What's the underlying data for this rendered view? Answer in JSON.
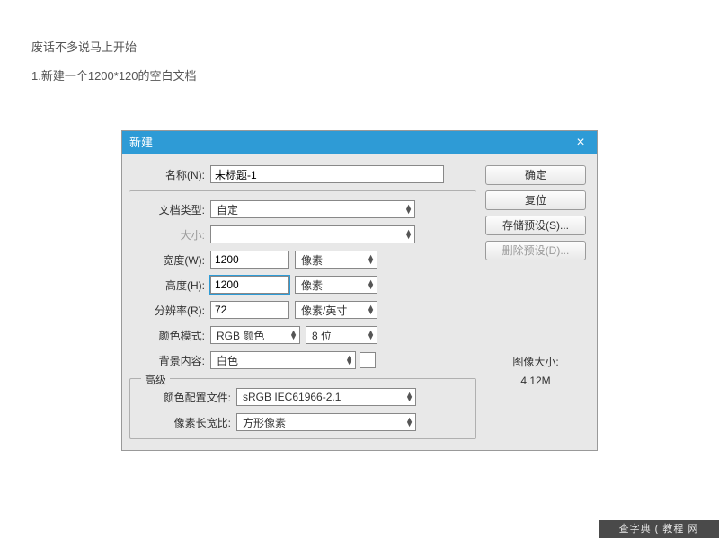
{
  "page": {
    "intro1": "废话不多说马上开始",
    "intro2": "1.新建一个1200*120的空白文档"
  },
  "dialog": {
    "title": "新建",
    "name_label": "名称(N):",
    "name_value": "未标题-1",
    "doctype_label": "文档类型:",
    "doctype_value": "自定",
    "size_label": "大小:",
    "size_value": "",
    "width_label": "宽度(W):",
    "width_value": "1200",
    "width_unit": "像素",
    "height_label": "高度(H):",
    "height_value": "1200",
    "height_unit": "像素",
    "res_label": "分辨率(R):",
    "res_value": "72",
    "res_unit": "像素/英寸",
    "mode_label": "颜色模式:",
    "mode_value": "RGB 颜色",
    "bits_value": "8 位",
    "bg_label": "背景内容:",
    "bg_value": "白色",
    "adv_legend": "高级",
    "profile_label": "颜色配置文件:",
    "profile_value": "sRGB IEC61966-2.1",
    "aspect_label": "像素长宽比:",
    "aspect_value": "方形像素"
  },
  "buttons": {
    "ok": "确定",
    "reset": "复位",
    "save_preset": "存储预设(S)...",
    "delete_preset": "删除预设(D)..."
  },
  "imagesize": {
    "label": "图像大小:",
    "value": "4.12M"
  },
  "watermark": "查字典 ( 教程 网"
}
